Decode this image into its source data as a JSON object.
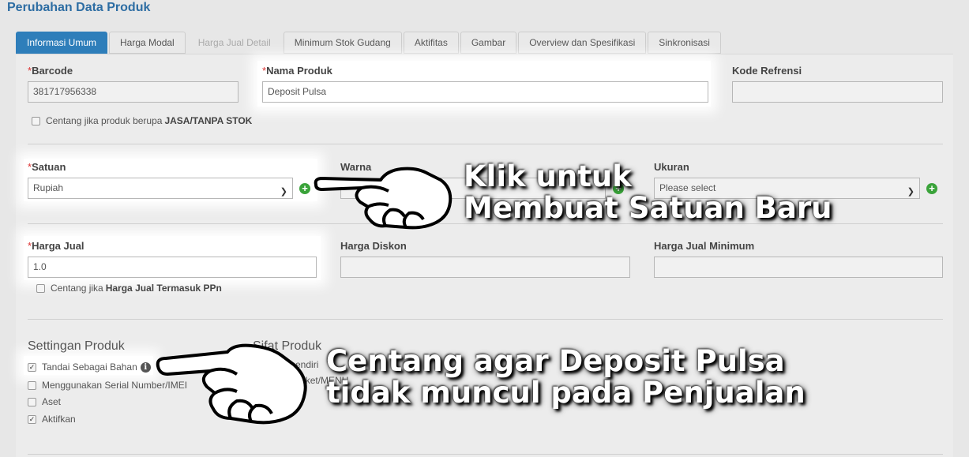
{
  "page": {
    "title": "Perubahan Data Produk"
  },
  "tabs": [
    {
      "label": "Informasi Umum",
      "state": "active"
    },
    {
      "label": "Harga Modal",
      "state": "normal"
    },
    {
      "label": "Harga Jual Detail",
      "state": "disabled"
    },
    {
      "label": "Minimum Stok Gudang",
      "state": "normal"
    },
    {
      "label": "Aktifitas",
      "state": "normal"
    },
    {
      "label": "Gambar",
      "state": "normal"
    },
    {
      "label": "Overview dan Spesifikasi",
      "state": "normal"
    },
    {
      "label": "Sinkronisasi",
      "state": "normal"
    }
  ],
  "form": {
    "barcode": {
      "label": "Barcode",
      "value": "381717956338"
    },
    "nama_produk": {
      "label": "Nama Produk",
      "value": "Deposit Pulsa"
    },
    "kode_refrensi": {
      "label": "Kode Refrensi",
      "value": ""
    },
    "jasa_check": {
      "text": "Centang jika produk berupa",
      "bold": "JASA/TANPA STOK"
    },
    "satuan": {
      "label": "Satuan",
      "value": "Rupiah"
    },
    "warna": {
      "label": "Warna",
      "value": ""
    },
    "ukuran": {
      "label": "Ukuran",
      "value": "Please select"
    },
    "harga_jual": {
      "label": "Harga Jual",
      "value": "1.0"
    },
    "harga_diskon": {
      "label": "Harga Diskon",
      "value": ""
    },
    "harga_jual_minimum": {
      "label": "Harga Jual Minimum",
      "value": ""
    },
    "ppn_check": {
      "text": "Centang jika",
      "bold": "Harga Jual Termasuk PPn"
    }
  },
  "settingan": {
    "title": "Settingan Produk",
    "items": [
      {
        "label": "Tandai Sebagai Bahan",
        "checked": true
      },
      {
        "label": "Menggunakan Serial Number/IMEI",
        "checked": false
      },
      {
        "label": "Aset",
        "checked": false
      },
      {
        "label": "Aktifkan",
        "checked": true
      }
    ]
  },
  "sifat": {
    "title": "Sifat Produk",
    "items": [
      "Berdiri sendiri",
      "Berupa Paket/MENU"
    ]
  },
  "annotations": {
    "satuan_callout": [
      "Klik untuk",
      "Membuat Satuan Baru"
    ],
    "bahan_callout": [
      "Centang agar Deposit Pulsa",
      "tidak muncul pada Penjualan"
    ]
  },
  "colors": {
    "accent": "#2e7eba",
    "title": "#2d6da3",
    "add": "#3aa33a",
    "required": "#dd3333"
  },
  "icons": {
    "add": "plus-circle-icon",
    "info": "info-icon",
    "pointer": "pointing-hand-icon"
  }
}
